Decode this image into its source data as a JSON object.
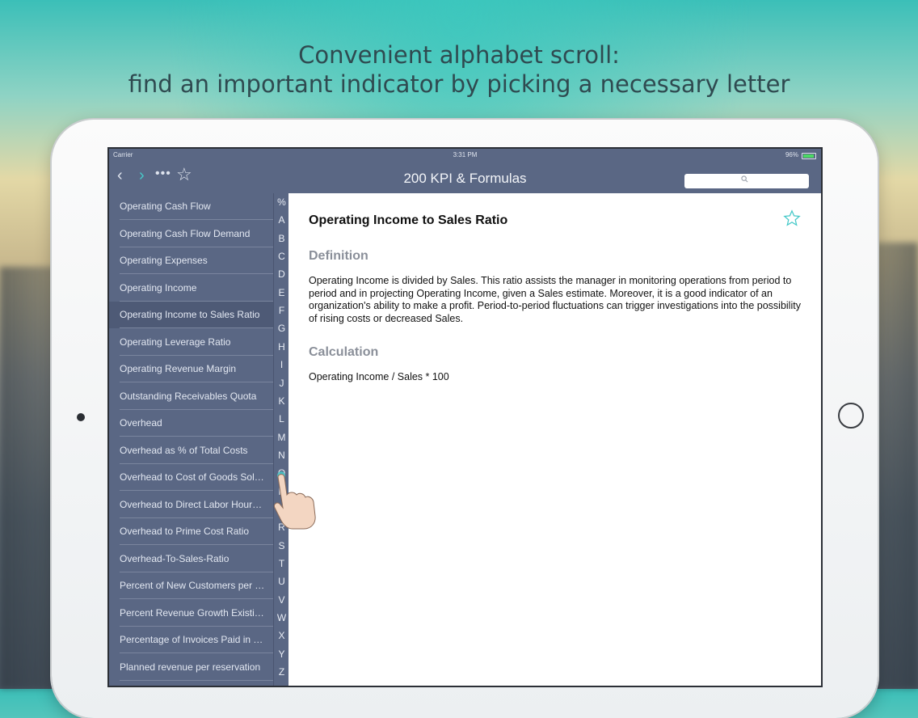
{
  "promo": {
    "line1": "Convenient alphabet scroll:",
    "line2": "find an important indicator by picking a necessary letter"
  },
  "status": {
    "carrier": "Carrier",
    "time": "3:31 PM",
    "battery": "96%"
  },
  "nav": {
    "back": "‹",
    "forward": "›",
    "more": "•••",
    "star": "☆",
    "title": "200 KPI & Formulas"
  },
  "list": [
    "Operating Cash Flow",
    "Operating Cash Flow Demand",
    "Operating Expenses",
    "Operating Income",
    "Operating Income to Sales Ratio",
    "Operating Leverage Ratio",
    "Operating Revenue Margin",
    "Outstanding Receivables Quota",
    "Overhead",
    "Overhead as % of Total Costs",
    "Overhead to Cost of Goods Sold...",
    "Overhead to Direct Labor Hours...",
    "Overhead to Prime Cost Ratio",
    "Overhead-To-Sales-Ratio",
    "Percent of New Customers per Y...",
    "Percent Revenue Growth Existin...",
    "Percentage of Invoices Paid in Ti...",
    "Planned revenue per reservation"
  ],
  "selected_index": 4,
  "alphabet": [
    "%",
    "A",
    "B",
    "C",
    "D",
    "E",
    "F",
    "G",
    "H",
    "I",
    "J",
    "K",
    "L",
    "M",
    "N",
    "O",
    "P",
    "Q",
    "R",
    "S",
    "T",
    "U",
    "V",
    "W",
    "X",
    "Y",
    "Z"
  ],
  "detail": {
    "title": "Operating Income to Sales Ratio",
    "definition_heading": "Definition",
    "definition": "Operating Income is divided by Sales. This ratio assists the manager in monitoring operations from period to period and in projecting Operating Income, given a Sales estimate. Moreover, it is a good indicator of an organization's ability to  make a profit. Period-to-period fluctuations can trigger investigations into the possibility of rising costs or decreased Sales.",
    "calculation_heading": "Calculation",
    "calculation": "Operating Income / Sales * 100"
  },
  "colors": {
    "accent": "#47c9c9",
    "sidebar": "#5a6784",
    "selected": "#4e5a76"
  }
}
